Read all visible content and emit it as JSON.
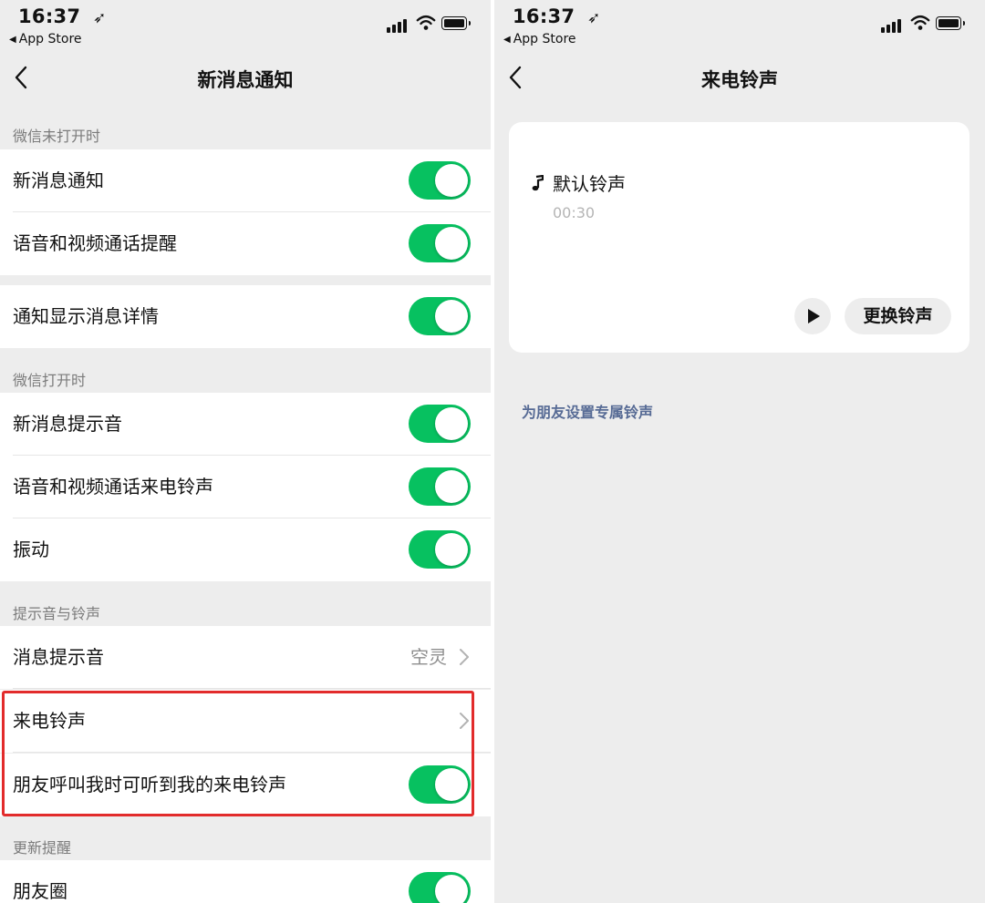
{
  "colors": {
    "switch_on": "#07c160",
    "link": "#576b95",
    "highlight": "#e22b2b",
    "background": "#ededed"
  },
  "status_bar": {
    "time": "16:37",
    "back_app": "App Store",
    "icons": [
      "location-arrow-icon",
      "signal-icon",
      "wifi-icon",
      "battery-icon"
    ]
  },
  "left": {
    "nav": {
      "title": "新消息通知"
    },
    "sections": [
      {
        "header": "微信未打开时",
        "rows": [
          {
            "label": "新消息通知",
            "control": "switch",
            "on": true
          },
          {
            "label": "语音和视频通话提醒",
            "control": "switch",
            "on": true
          }
        ]
      },
      {
        "header": "",
        "rows": [
          {
            "label": "通知显示消息详情",
            "control": "switch",
            "on": true
          }
        ]
      },
      {
        "header": "微信打开时",
        "rows": [
          {
            "label": "新消息提示音",
            "control": "switch",
            "on": true
          },
          {
            "label": "语音和视频通话来电铃声",
            "control": "switch",
            "on": true
          },
          {
            "label": "振动",
            "control": "switch",
            "on": true
          }
        ]
      },
      {
        "header": "提示音与铃声",
        "rows": [
          {
            "label": "消息提示音",
            "control": "chevron",
            "value": "空灵"
          },
          {
            "label": "来电铃声",
            "control": "chevron",
            "value": ""
          },
          {
            "label": "朋友呼叫我时可听到我的来电铃声",
            "control": "switch",
            "on": true
          }
        ]
      },
      {
        "header": "更新提醒",
        "rows": [
          {
            "label": "朋友圈",
            "control": "switch",
            "on": true
          }
        ]
      }
    ]
  },
  "right": {
    "nav": {
      "title": "来电铃声"
    },
    "ringtone": {
      "icon": "music-note-icon",
      "name": "默认铃声",
      "duration": "00:30"
    },
    "play_icon": "play-icon",
    "change_button": "更换铃声",
    "friend_link": "为朋友设置专属铃声"
  }
}
